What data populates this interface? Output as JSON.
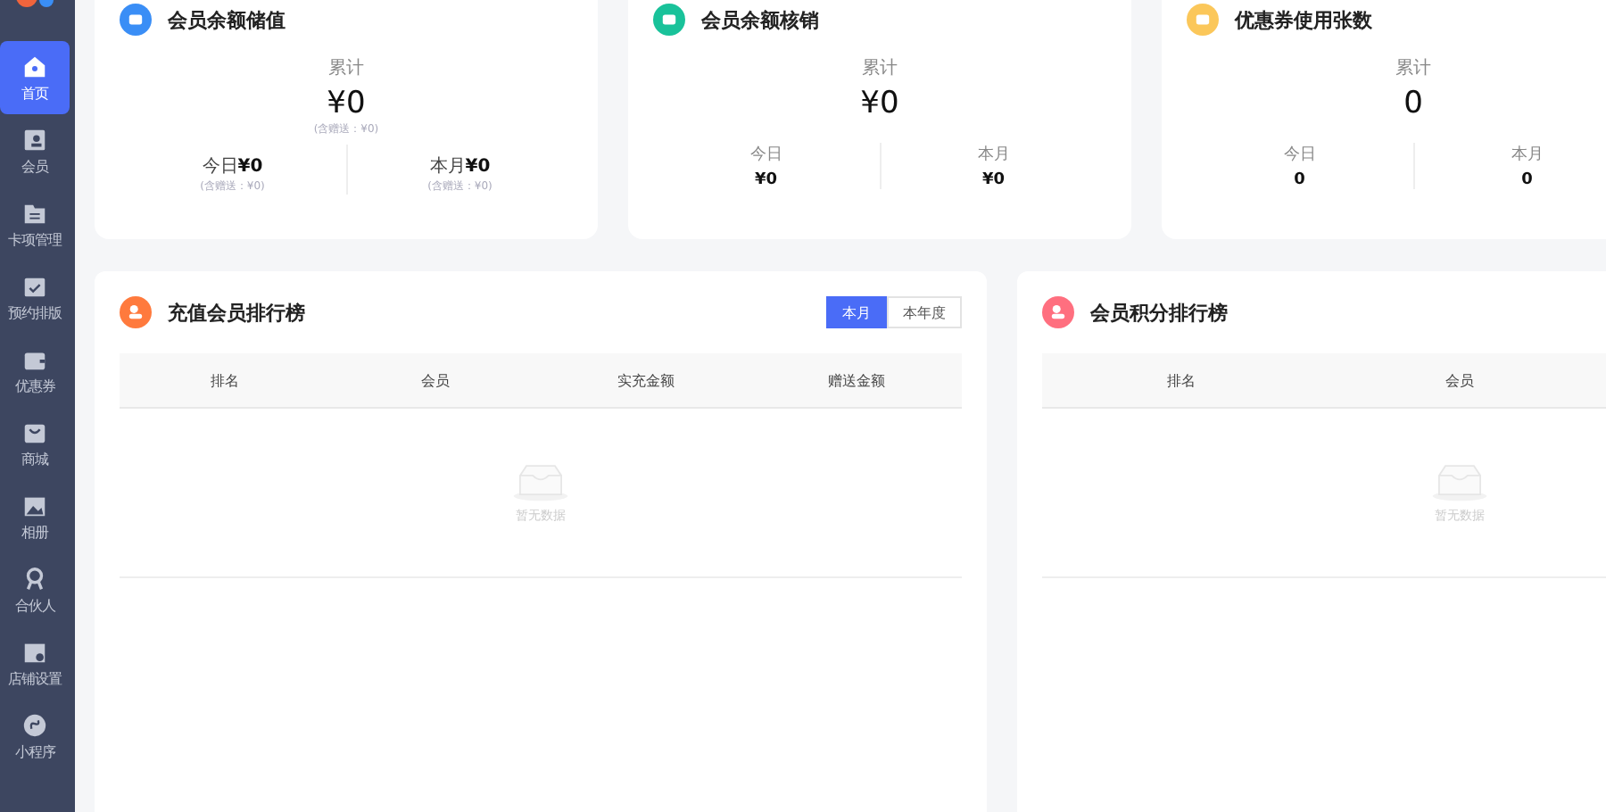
{
  "sidebar": {
    "items": [
      {
        "label": "首页",
        "selected": true
      },
      {
        "label": "会员",
        "selected": false
      },
      {
        "label": "卡项管理",
        "selected": false
      },
      {
        "label": "预约排版",
        "selected": false
      },
      {
        "label": "优惠券",
        "selected": false
      },
      {
        "label": "商城",
        "selected": false
      },
      {
        "label": "相册",
        "selected": false
      },
      {
        "label": "合伙人",
        "selected": false
      },
      {
        "label": "店铺设置",
        "selected": false
      },
      {
        "label": "小程序",
        "selected": false
      }
    ]
  },
  "stat_cards": [
    {
      "kind": "inline",
      "title": "会员余额储值",
      "color": "#3a8ef6",
      "total_label": "累计",
      "total": "¥0",
      "total_note": "(含赠送：¥0)",
      "periods": [
        {
          "label": "今日",
          "value": "¥0",
          "note": "(含赠送：¥0)"
        },
        {
          "label": "本月",
          "value": "¥0",
          "note": "(含赠送：¥0)"
        }
      ]
    },
    {
      "kind": "stacked",
      "title": "会员余额核销",
      "color": "#19c29a",
      "total_label": "累计",
      "total": "¥0",
      "periods": [
        {
          "label": "今日",
          "value": "¥0"
        },
        {
          "label": "本月",
          "value": "¥0"
        }
      ]
    },
    {
      "kind": "stacked",
      "title": "优惠券使用张数",
      "color": "#fbc75a",
      "total_label": "累计",
      "total": "0",
      "periods": [
        {
          "label": "今日",
          "value": "0"
        },
        {
          "label": "本月",
          "value": "0"
        }
      ]
    }
  ],
  "rankings": [
    {
      "title": "充值会员排行榜",
      "color": "#ff7a3d",
      "toggle": [
        {
          "label": "本月",
          "selected": true
        },
        {
          "label": "本年度",
          "selected": false
        }
      ],
      "columns": [
        "排名",
        "会员",
        "实充金额",
        "赠送金额"
      ],
      "empty_text": "暂无数据"
    },
    {
      "title": "会员积分排行榜",
      "color": "#ff6f7f",
      "columns": [
        "排名",
        "会员"
      ],
      "empty_text": "暂无数据"
    }
  ]
}
